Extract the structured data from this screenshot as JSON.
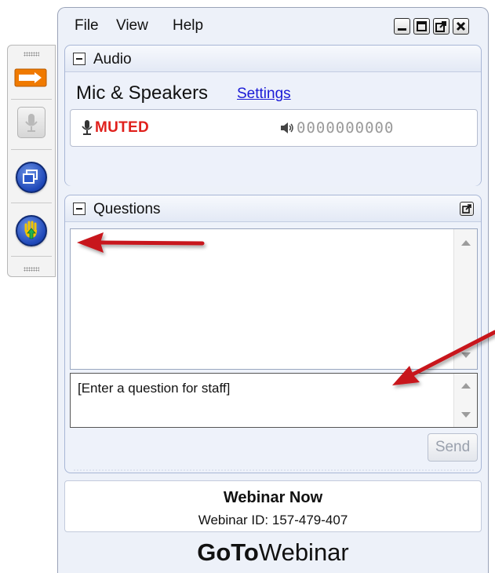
{
  "menu": {
    "file": "File",
    "view": "View",
    "help": "Help"
  },
  "audio": {
    "title": "Audio",
    "mode": "Mic & Speakers",
    "settings_link": "Settings",
    "status": "MUTED",
    "level_digits": "0000000000"
  },
  "questions": {
    "title": "Questions",
    "input_placeholder": "[Enter a question for staff]",
    "send_label": "Send"
  },
  "webinar": {
    "title": "Webinar Now",
    "id_text": "Webinar ID: 157-479-407"
  },
  "brand": {
    "part1": "GoTo",
    "part2": "Webinar"
  },
  "colors": {
    "muted_red": "#e0201c",
    "link_blue": "#1a1ad6",
    "annotation_red": "#c8181d",
    "toolbar_orange": "#f07a00"
  }
}
